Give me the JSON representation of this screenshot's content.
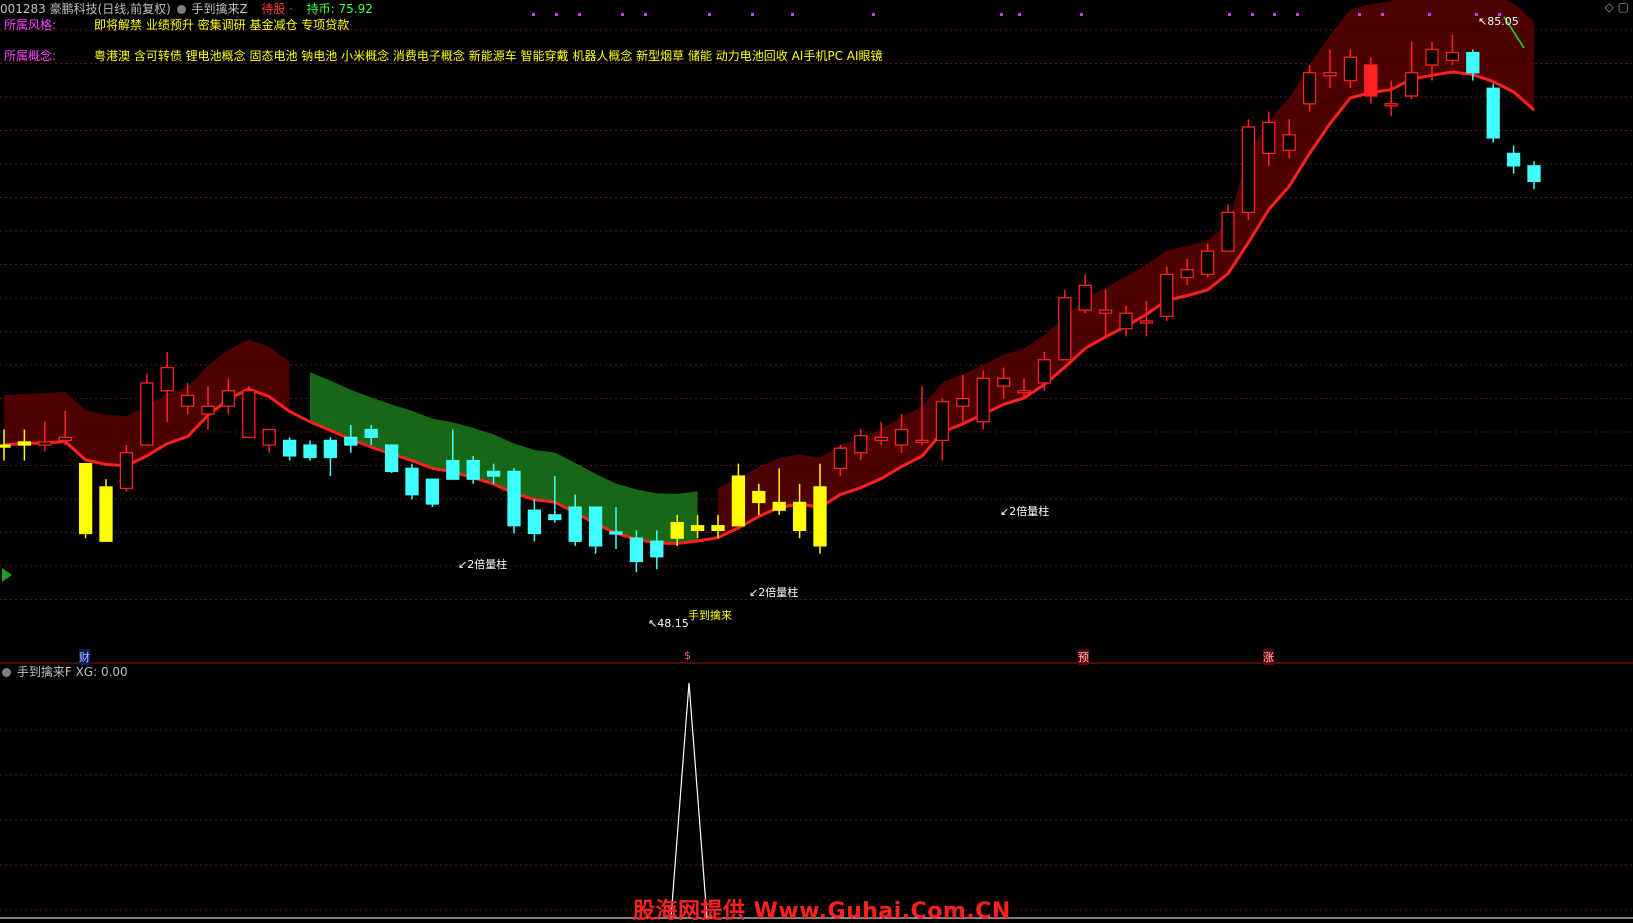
{
  "header": {
    "stock": "001283 豪鹏科技(日线,前复权)",
    "indicator_name": "手到擒来Z",
    "signal_label": "待股 ·",
    "hold_label": "持币: 75.92"
  },
  "info_rows": [
    {
      "label": "所属风格:",
      "value": "即将解禁 业绩预升 密集调研 基金减仓 专项贷款"
    },
    {
      "label": "所属概念:",
      "value": "粤港澳 含可转债 锂电池概念 固态电池 钠电池 小米概念 消费电子概念 新能源车 智能穿戴 机器人概念 新型烟草 储能 动力电池回收 AI手机PC AI眼镜"
    }
  ],
  "price_marks": {
    "high": "85.05",
    "low": "48.15"
  },
  "annotations": [
    "2倍量柱",
    "2倍量柱",
    "2倍量柱",
    "手到擒来"
  ],
  "event_markers": [
    "财",
    "$",
    "预",
    "涨"
  ],
  "sub_panel": {
    "title": "手到擒来F",
    "xg": "XG: 0.00"
  },
  "watermark": "股海网提供 Www.Guhai.Com.CN",
  "colors": {
    "up": "#ff2020",
    "down": "#40ffff",
    "signal": "#ffff00",
    "ma": "#ff2020",
    "band_up": "#5a0000",
    "band_down": "#1a7a1a"
  },
  "chart_data": {
    "type": "candlestick",
    "low_mark": 48.15,
    "high_mark": 85.05,
    "candles": [
      {
        "o": 58.6,
        "h": 59.6,
        "l": 57.6,
        "c": 58.6,
        "kind": "signal"
      },
      {
        "o": 58.6,
        "h": 59.6,
        "l": 57.6,
        "c": 58.8,
        "kind": "signal"
      },
      {
        "o": 58.6,
        "h": 60.1,
        "l": 58.2,
        "c": 58.8,
        "kind": "up"
      },
      {
        "o": 58.9,
        "h": 60.8,
        "l": 58.6,
        "c": 59.1,
        "kind": "up"
      },
      {
        "o": 57.4,
        "h": 57.4,
        "l": 52.6,
        "c": 52.9,
        "kind": "signal"
      },
      {
        "o": 52.4,
        "h": 56.4,
        "l": 52.4,
        "c": 55.9,
        "kind": "signal"
      },
      {
        "o": 55.8,
        "h": 58.6,
        "l": 55.6,
        "c": 58.1,
        "kind": "up"
      },
      {
        "o": 58.6,
        "h": 63.2,
        "l": 58.6,
        "c": 62.6,
        "kind": "up"
      },
      {
        "o": 62.1,
        "h": 64.6,
        "l": 60.1,
        "c": 63.6,
        "kind": "up"
      },
      {
        "o": 61.1,
        "h": 62.6,
        "l": 60.6,
        "c": 61.8,
        "kind": "up"
      },
      {
        "o": 60.6,
        "h": 62.4,
        "l": 59.6,
        "c": 61.1,
        "kind": "up"
      },
      {
        "o": 61.1,
        "h": 62.9,
        "l": 60.6,
        "c": 62.1,
        "kind": "up"
      },
      {
        "o": 59.1,
        "h": 62.4,
        "l": 59.1,
        "c": 62.1,
        "kind": "up"
      },
      {
        "o": 58.6,
        "h": 59.6,
        "l": 58.1,
        "c": 59.6,
        "kind": "up"
      },
      {
        "o": 58.9,
        "h": 59.1,
        "l": 57.6,
        "c": 57.9,
        "kind": "down"
      },
      {
        "o": 58.6,
        "h": 58.9,
        "l": 57.6,
        "c": 57.8,
        "kind": "down"
      },
      {
        "o": 58.9,
        "h": 59.1,
        "l": 56.6,
        "c": 57.8,
        "kind": "down"
      },
      {
        "o": 59.1,
        "h": 59.9,
        "l": 58.1,
        "c": 58.6,
        "kind": "down"
      },
      {
        "o": 59.6,
        "h": 59.9,
        "l": 58.6,
        "c": 59.1,
        "kind": "down"
      },
      {
        "o": 58.6,
        "h": 58.6,
        "l": 56.8,
        "c": 56.9,
        "kind": "down"
      },
      {
        "o": 57.1,
        "h": 57.4,
        "l": 55.1,
        "c": 55.4,
        "kind": "down"
      },
      {
        "o": 56.4,
        "h": 56.4,
        "l": 54.6,
        "c": 54.8,
        "kind": "down"
      },
      {
        "o": 57.6,
        "h": 59.6,
        "l": 56.4,
        "c": 56.4,
        "kind": "down"
      },
      {
        "o": 57.6,
        "h": 57.9,
        "l": 56.1,
        "c": 56.4,
        "kind": "down"
      },
      {
        "o": 56.9,
        "h": 57.4,
        "l": 56.1,
        "c": 56.6,
        "kind": "down"
      },
      {
        "o": 56.9,
        "h": 57.1,
        "l": 52.9,
        "c": 53.4,
        "kind": "down"
      },
      {
        "o": 54.4,
        "h": 55.1,
        "l": 52.4,
        "c": 52.9,
        "kind": "down"
      },
      {
        "o": 54.1,
        "h": 56.6,
        "l": 53.6,
        "c": 53.8,
        "kind": "down"
      },
      {
        "o": 54.6,
        "h": 55.4,
        "l": 52.1,
        "c": 52.4,
        "kind": "down"
      },
      {
        "o": 54.6,
        "h": 54.6,
        "l": 51.6,
        "c": 52.1,
        "kind": "down"
      },
      {
        "o": 53.0,
        "h": 54.6,
        "l": 51.9,
        "c": 52.9,
        "kind": "down"
      },
      {
        "o": 52.6,
        "h": 53.1,
        "l": 50.4,
        "c": 51.1,
        "kind": "down"
      },
      {
        "o": 52.4,
        "h": 53.1,
        "l": 50.6,
        "c": 51.4,
        "kind": "down"
      },
      {
        "o": 52.6,
        "h": 54.1,
        "l": 52.1,
        "c": 53.6,
        "kind": "signal"
      },
      {
        "o": 53.1,
        "h": 54.1,
        "l": 52.6,
        "c": 53.4,
        "kind": "signal"
      },
      {
        "o": 53.1,
        "h": 54.1,
        "l": 52.6,
        "c": 53.4,
        "kind": "signal"
      },
      {
        "o": 53.4,
        "h": 57.4,
        "l": 53.4,
        "c": 56.6,
        "kind": "signal"
      },
      {
        "o": 54.9,
        "h": 56.1,
        "l": 54.1,
        "c": 55.6,
        "kind": "signal"
      },
      {
        "o": 54.4,
        "h": 57.1,
        "l": 54.1,
        "c": 54.9,
        "kind": "signal"
      },
      {
        "o": 53.1,
        "h": 56.1,
        "l": 52.6,
        "c": 54.9,
        "kind": "signal"
      },
      {
        "o": 55.9,
        "h": 57.4,
        "l": 51.6,
        "c": 52.1,
        "kind": "signal"
      },
      {
        "o": 57.1,
        "h": 58.6,
        "l": 56.6,
        "c": 58.4,
        "kind": "up"
      },
      {
        "o": 58.1,
        "h": 59.6,
        "l": 57.6,
        "c": 59.2,
        "kind": "up"
      },
      {
        "o": 58.9,
        "h": 60.1,
        "l": 58.6,
        "c": 59.1,
        "kind": "up"
      },
      {
        "o": 58.6,
        "h": 60.6,
        "l": 58.1,
        "c": 59.6,
        "kind": "up"
      },
      {
        "o": 58.9,
        "h": 62.4,
        "l": 58.6,
        "c": 58.9,
        "kind": "up"
      },
      {
        "o": 58.9,
        "h": 61.6,
        "l": 57.6,
        "c": 61.4,
        "kind": "up"
      },
      {
        "o": 61.1,
        "h": 63.1,
        "l": 60.1,
        "c": 61.6,
        "kind": "up"
      },
      {
        "o": 60.1,
        "h": 63.4,
        "l": 59.6,
        "c": 62.9,
        "kind": "up"
      },
      {
        "o": 62.4,
        "h": 63.6,
        "l": 61.6,
        "c": 62.9,
        "kind": "up"
      },
      {
        "o": 62.1,
        "h": 62.9,
        "l": 61.6,
        "c": 62.1,
        "kind": "up"
      },
      {
        "o": 62.6,
        "h": 64.6,
        "l": 62.1,
        "c": 64.1,
        "kind": "up"
      },
      {
        "o": 64.1,
        "h": 68.6,
        "l": 64.1,
        "c": 68.1,
        "kind": "up"
      },
      {
        "o": 67.3,
        "h": 69.6,
        "l": 67.1,
        "c": 68.9,
        "kind": "up"
      },
      {
        "o": 67.1,
        "h": 68.6,
        "l": 65.6,
        "c": 67.3,
        "kind": "up"
      },
      {
        "o": 66.1,
        "h": 67.6,
        "l": 65.6,
        "c": 67.1,
        "kind": "up"
      },
      {
        "o": 66.6,
        "h": 67.9,
        "l": 65.6,
        "c": 66.6,
        "kind": "up"
      },
      {
        "o": 66.9,
        "h": 70.1,
        "l": 66.6,
        "c": 69.6,
        "kind": "up"
      },
      {
        "o": 69.4,
        "h": 70.6,
        "l": 68.9,
        "c": 69.9,
        "kind": "up"
      },
      {
        "o": 69.6,
        "h": 71.6,
        "l": 69.4,
        "c": 71.1,
        "kind": "up"
      },
      {
        "o": 71.1,
        "h": 74.1,
        "l": 71.1,
        "c": 73.6,
        "kind": "up"
      },
      {
        "o": 73.6,
        "h": 79.6,
        "l": 73.1,
        "c": 79.1,
        "kind": "up"
      },
      {
        "o": 77.4,
        "h": 80.1,
        "l": 76.6,
        "c": 79.4,
        "kind": "up"
      },
      {
        "o": 77.6,
        "h": 79.6,
        "l": 77.1,
        "c": 78.6,
        "kind": "up"
      },
      {
        "o": 80.6,
        "h": 83.1,
        "l": 80.1,
        "c": 82.6,
        "kind": "up"
      },
      {
        "o": 82.4,
        "h": 84.1,
        "l": 81.6,
        "c": 82.6,
        "kind": "up"
      },
      {
        "o": 82.1,
        "h": 84.1,
        "l": 81.6,
        "c": 83.6,
        "kind": "up"
      },
      {
        "o": 83.1,
        "h": 83.6,
        "l": 80.6,
        "c": 81.1,
        "kind": "up"
      },
      {
        "o": 80.6,
        "h": 82.1,
        "l": 79.8,
        "c": 80.6,
        "kind": "up"
      },
      {
        "o": 81.1,
        "h": 84.6,
        "l": 80.9,
        "c": 82.6,
        "kind": "up"
      },
      {
        "o": 83.1,
        "h": 84.6,
        "l": 82.1,
        "c": 84.1,
        "kind": "up"
      },
      {
        "o": 83.4,
        "h": 85.05,
        "l": 83.1,
        "c": 83.9,
        "kind": "up"
      },
      {
        "o": 83.9,
        "h": 84.1,
        "l": 82.1,
        "c": 82.6,
        "kind": "down"
      },
      {
        "o": 81.6,
        "h": 81.9,
        "l": 78.1,
        "c": 78.4,
        "kind": "down"
      },
      {
        "o": 77.4,
        "h": 77.9,
        "l": 76.1,
        "c": 76.6,
        "kind": "down"
      },
      {
        "o": 76.6,
        "h": 76.9,
        "l": 75.1,
        "c": 75.6,
        "kind": "down"
      }
    ]
  }
}
